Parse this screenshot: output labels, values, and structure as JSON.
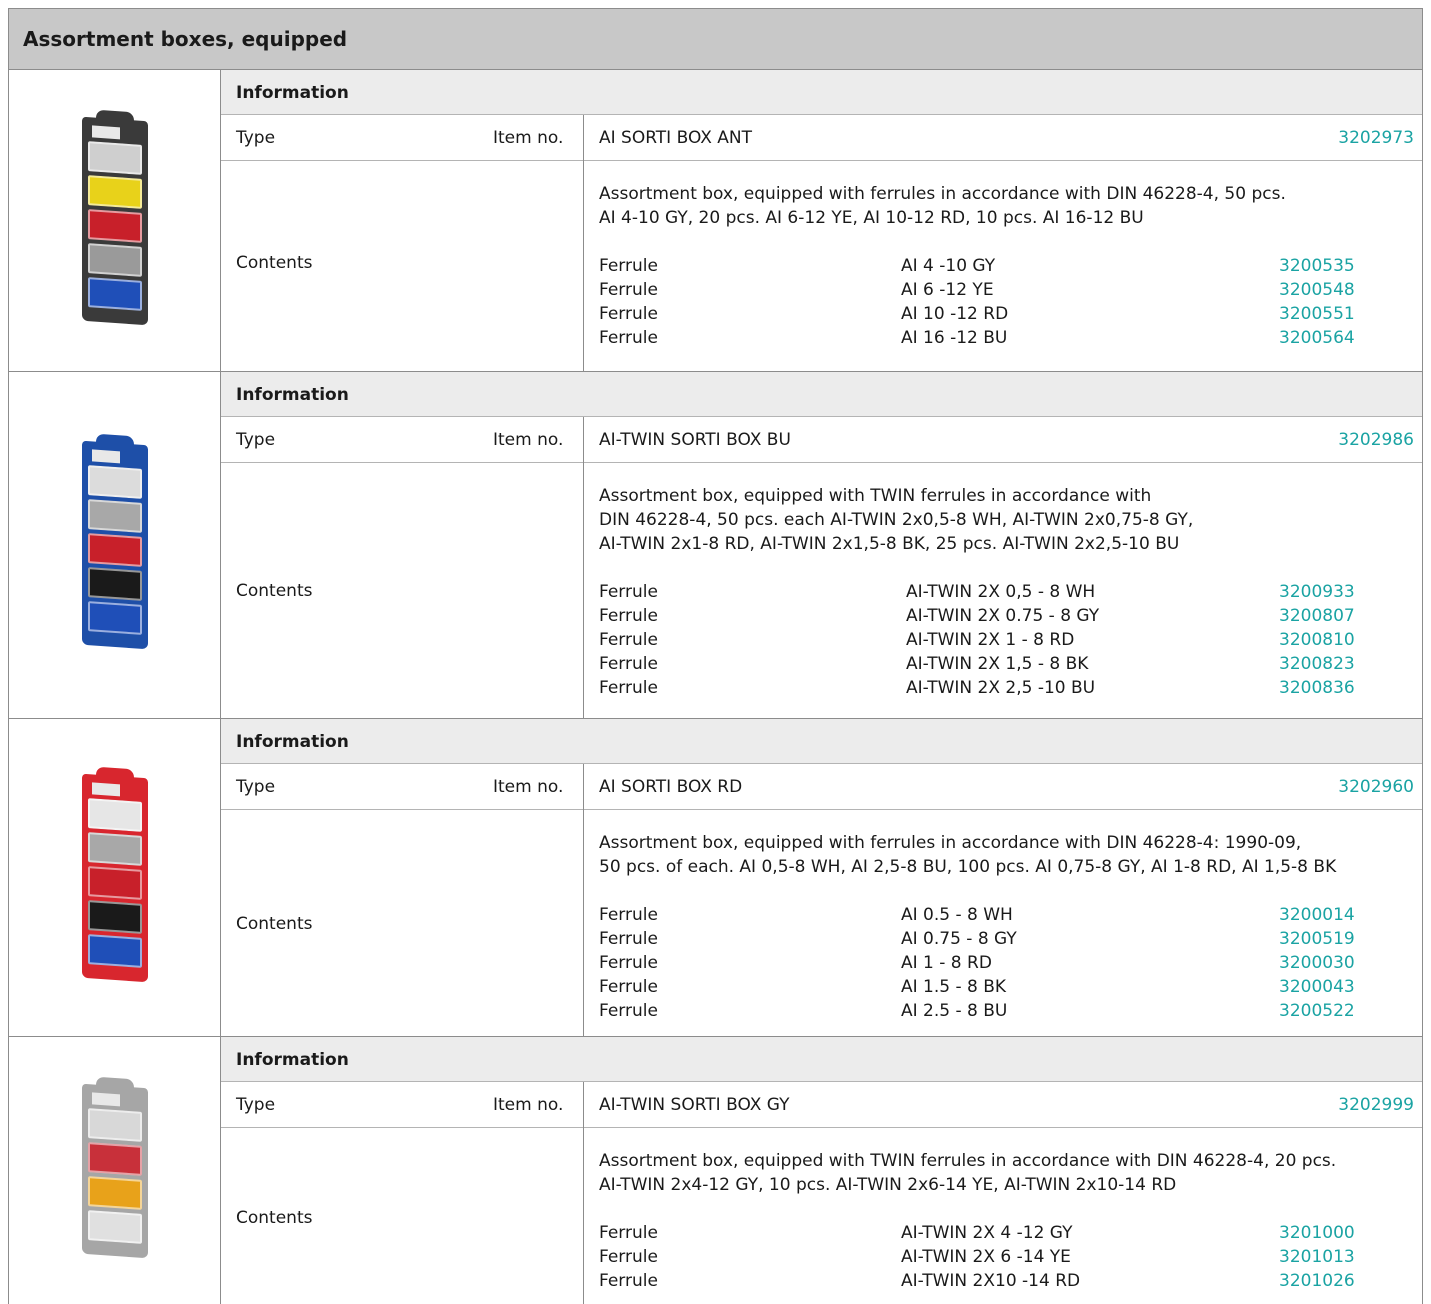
{
  "page_title": "Assortment boxes, equipped",
  "labels": {
    "information": "Information",
    "type": "Type",
    "item_no": "Item no.",
    "contents": "Contents"
  },
  "colors": {
    "link": "#1aa3a3",
    "header_bg": "#c8c8c8",
    "info_bg": "#ececec"
  },
  "products": [
    {
      "type_name": "AI SORTI BOX ANT",
      "item_no": "3202973",
      "image": "ferrule-assortment-box-anthracite",
      "box_color": "#3a3a3a",
      "drawer_colors": [
        "#cfcfcf",
        "#e8d21a",
        "#c8202a",
        "#9a9a9a",
        "#1f4fb8"
      ],
      "description": [
        "Assortment box, equipped with ferrules in accordance with DIN 46228-4, 50 pcs.",
        "AI 4-10 GY, 20 pcs. AI 6-12 YE, AI 10-12 RD, 10 pcs. AI 16-12 BU"
      ],
      "ferrules": [
        {
          "name": "Ferrule",
          "type": "AI 4 -10 GY",
          "item_no": "3200535"
        },
        {
          "name": "Ferrule",
          "type": "AI 6 -12 YE",
          "item_no": "3200548"
        },
        {
          "name": "Ferrule",
          "type": "AI 10 -12 RD",
          "item_no": "3200551"
        },
        {
          "name": "Ferrule",
          "type": "AI 16 -12 BU",
          "item_no": "3200564"
        }
      ]
    },
    {
      "type_name": "AI-TWIN SORTI BOX BU",
      "item_no": "3202986",
      "image": "ferrule-assortment-box-blue",
      "box_color": "#1e4fa8",
      "drawer_colors": [
        "#dcdcdc",
        "#a8a8a8",
        "#c8202a",
        "#1a1a1a",
        "#1f4fb8"
      ],
      "description": [
        "Assortment box, equipped with TWIN ferrules in accordance with",
        "DIN 46228-4, 50 pcs. each AI-TWIN 2x0,5-8 WH, AI-TWIN 2x0,75-8 GY,",
        "AI-TWIN 2x1-8 RD, AI-TWIN 2x1,5-8 BK, 25 pcs. AI-TWIN 2x2,5-10 BU"
      ],
      "ferrules": [
        {
          "name": "Ferrule",
          "type": "AI-TWIN 2X 0,5 - 8 WH",
          "item_no": "3200933"
        },
        {
          "name": "Ferrule",
          "type": "AI-TWIN 2X 0.75 - 8 GY",
          "item_no": "3200807"
        },
        {
          "name": "Ferrule",
          "type": "AI-TWIN 2X 1 - 8 RD",
          "item_no": "3200810"
        },
        {
          "name": "Ferrule",
          "type": "AI-TWIN 2X 1,5 - 8 BK",
          "item_no": "3200823"
        },
        {
          "name": "Ferrule",
          "type": "AI-TWIN 2X 2,5 -10 BU",
          "item_no": "3200836"
        }
      ]
    },
    {
      "type_name": "AI SORTI BOX RD",
      "item_no": "3202960",
      "image": "ferrule-assortment-box-red",
      "box_color": "#d8262e",
      "drawer_colors": [
        "#e6e6e6",
        "#a8a8a8",
        "#c8202a",
        "#1a1a1a",
        "#1f4fb8"
      ],
      "description": [
        "Assortment box, equipped with ferrules in accordance with DIN 46228-4: 1990-09,",
        "50 pcs. of each. AI 0,5-8 WH, AI 2,5-8 BU, 100 pcs. AI 0,75-8 GY, AI 1-8 RD, AI 1,5-8 BK"
      ],
      "ferrules": [
        {
          "name": "Ferrule",
          "type": "AI 0.5 - 8 WH",
          "item_no": "3200014"
        },
        {
          "name": "Ferrule",
          "type": "AI 0.75 - 8 GY",
          "item_no": "3200519"
        },
        {
          "name": "Ferrule",
          "type": "AI 1 - 8 RD",
          "item_no": "3200030"
        },
        {
          "name": "Ferrule",
          "type": "AI 1.5 - 8 BK",
          "item_no": "3200043"
        },
        {
          "name": "Ferrule",
          "type": "AI 2.5 - 8 BU",
          "item_no": "3200522"
        }
      ]
    },
    {
      "type_name": "AI-TWIN SORTI BOX GY",
      "item_no": "3202999",
      "image": "ferrule-assortment-box-grey",
      "box_color": "#a6a6a6",
      "drawer_colors": [
        "#d8d8d8",
        "#c8303a",
        "#e8a21a",
        "#e0e0e0"
      ],
      "description": [
        "Assortment box, equipped with TWIN ferrules in accordance with DIN 46228-4, 20 pcs.",
        "AI-TWIN 2x4-12 GY, 10 pcs. AI-TWIN 2x6-14 YE, AI-TWIN 2x10-14 RD"
      ],
      "ferrules": [
        {
          "name": "Ferrule",
          "type": "AI-TWIN 2X 4 -12 GY",
          "item_no": "3201000"
        },
        {
          "name": "Ferrule",
          "type": "AI-TWIN 2X 6 -14 YE",
          "item_no": "3201013"
        },
        {
          "name": "Ferrule",
          "type": "AI-TWIN 2X10 -14 RD",
          "item_no": "3201026"
        }
      ]
    }
  ]
}
